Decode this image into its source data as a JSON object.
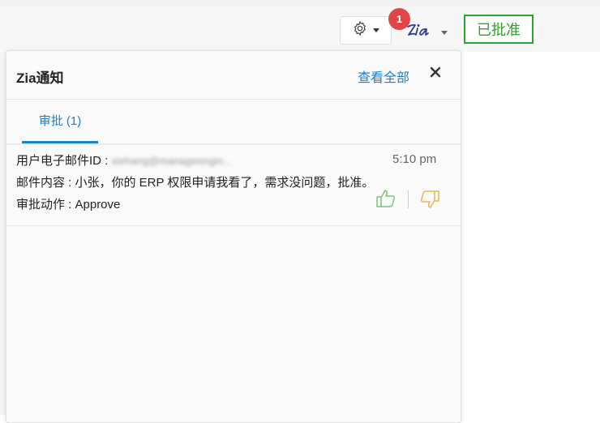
{
  "toolbar": {
    "settings_icon": "gear-icon",
    "zia_icon": "zia-logo-icon",
    "notification_count": "1",
    "approved_label": "已批准",
    "approved_color": "#2ea12e"
  },
  "panel": {
    "title": "Zia通知",
    "view_all": "查看全部",
    "close_icon": "close-icon",
    "tabs": [
      {
        "label": "审批 (1)",
        "active": true
      }
    ],
    "notification": {
      "email_label": "用户电子邮件ID :",
      "email_value": "xiehang@manageengin...",
      "time": "5:10 pm",
      "content": "邮件内容 : 小张，你的 ERP 权限申请我看了，需求没问题，批准。",
      "action": "审批动作 : Approve",
      "approve_icon": "thumbs-up-icon",
      "reject_icon": "thumbs-down-icon"
    }
  },
  "colors": {
    "accent": "#1a7fd0",
    "badge": "#e04646",
    "approve": "#7cc576",
    "reject": "#e8b84a"
  }
}
